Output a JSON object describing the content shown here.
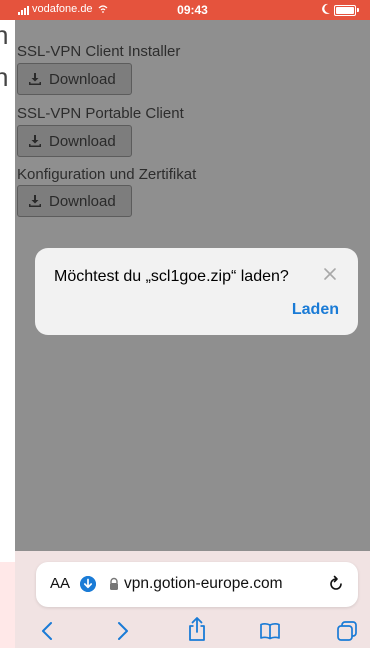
{
  "status_bar": {
    "carrier": "vodafone.de",
    "time": "09:43"
  },
  "background_page_fragments": [
    "h",
    "n"
  ],
  "sections": [
    {
      "title": "SSL-VPN Client Installer",
      "button_label": "Download"
    },
    {
      "title": "SSL-VPN Portable Client",
      "button_label": "Download"
    },
    {
      "title": "Konfiguration und Zertifikat",
      "button_label": "Download"
    }
  ],
  "dialog": {
    "message": "Möchtest du „scl1goe.zip“ laden?",
    "action_label": "Laden"
  },
  "url_bar": {
    "text_size_label": "AA",
    "url": "vpn.gotion-europe.com"
  },
  "toolbar_icons": [
    "back-icon",
    "forward-icon",
    "share-icon",
    "bookmarks-icon",
    "tabs-icon"
  ],
  "colors": {
    "status_bar": "#e5533d",
    "page_overlay": "#8f8f8f",
    "link_blue": "#1a7bd6",
    "bottom_bar": "#f1e3e3"
  }
}
